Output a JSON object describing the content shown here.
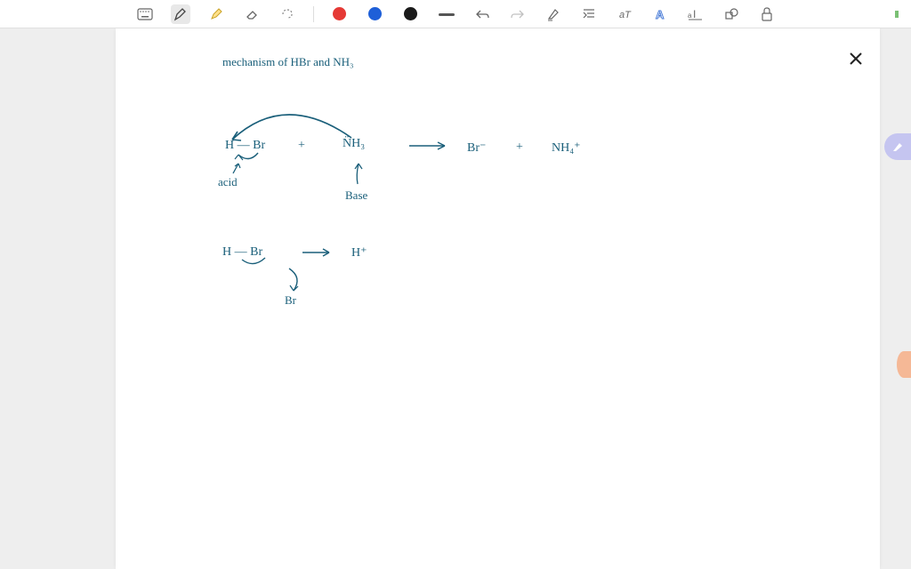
{
  "toolbar": {
    "keyboard_label": "keyboard",
    "pen_label": "pen",
    "highlighter_label": "highlighter",
    "eraser_label": "eraser",
    "lasso_label": "lasso",
    "color_red": "#e53935",
    "color_blue": "#1e5fd8",
    "color_black": "#1a1a1a",
    "stroke_label": "stroke-width",
    "undo_label": "undo",
    "redo_label": "redo",
    "pen_settings_label": "pen-settings",
    "indent_label": "indent",
    "text_label": "text-style",
    "font_label": "font-a",
    "text_size_label": "text-size",
    "shapes_label": "shapes",
    "lock_label": "lock"
  },
  "close_label": "×",
  "notes": {
    "title": "mechanism  of  HBr  and  NH₃",
    "line1_hbr": "H — Br",
    "line1_plus1": "+",
    "line1_nh3": "N̈H₃",
    "line1_arrow": "→",
    "line1_br_minus": "Br⁻",
    "line1_plus2": "+",
    "line1_nh4_plus": "NH₄⁺",
    "label_acid": "acid",
    "label_base": "Base",
    "line2_hbr": "H — Br",
    "line2_arrow": "→",
    "line2_h_plus": "H⁺",
    "line2_br": "Br"
  }
}
